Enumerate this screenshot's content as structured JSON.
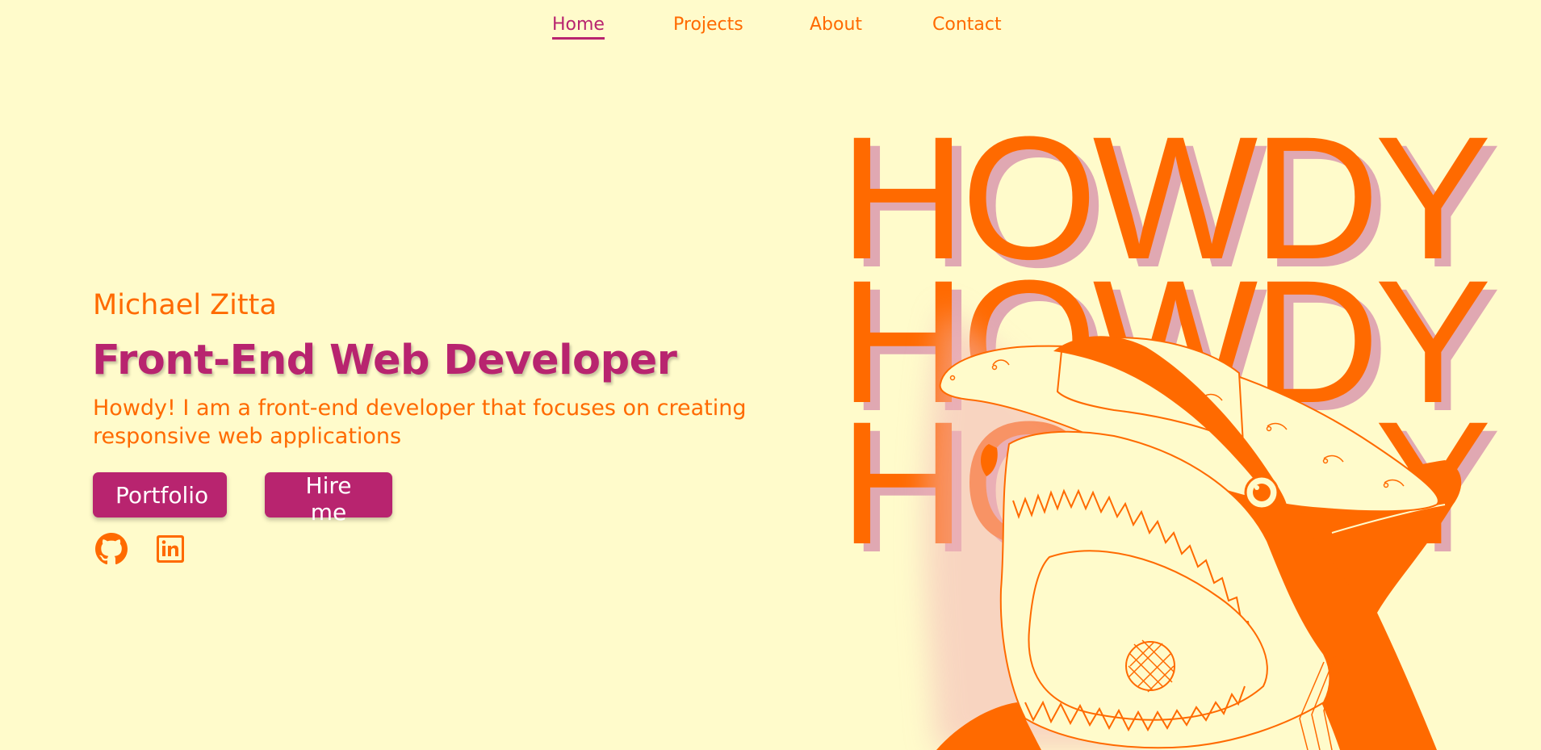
{
  "nav": {
    "items": [
      {
        "label": "Home",
        "active": true
      },
      {
        "label": "Projects",
        "active": false
      },
      {
        "label": "About",
        "active": false
      },
      {
        "label": "Contact",
        "active": false
      }
    ]
  },
  "hero": {
    "name": "Michael Zitta",
    "title": "Front-End Web Developer",
    "description": "Howdy! I am a front-end developer that focuses on creating responsive web applications",
    "buttons": {
      "portfolio": "Portfolio",
      "hire": "Hire me"
    },
    "social": [
      {
        "icon": "github-icon"
      },
      {
        "icon": "linkedin-icon"
      }
    ]
  },
  "art": {
    "howdy_lines": [
      "HOWDY",
      "HOWDY",
      "HOWDY"
    ],
    "illustration": "shark-with-cowboy-hat"
  },
  "colors": {
    "background": "#fffbcb",
    "accent_orange": "#ff6a00",
    "accent_magenta": "#b8246f",
    "shadow_pink": "#d68caa"
  }
}
